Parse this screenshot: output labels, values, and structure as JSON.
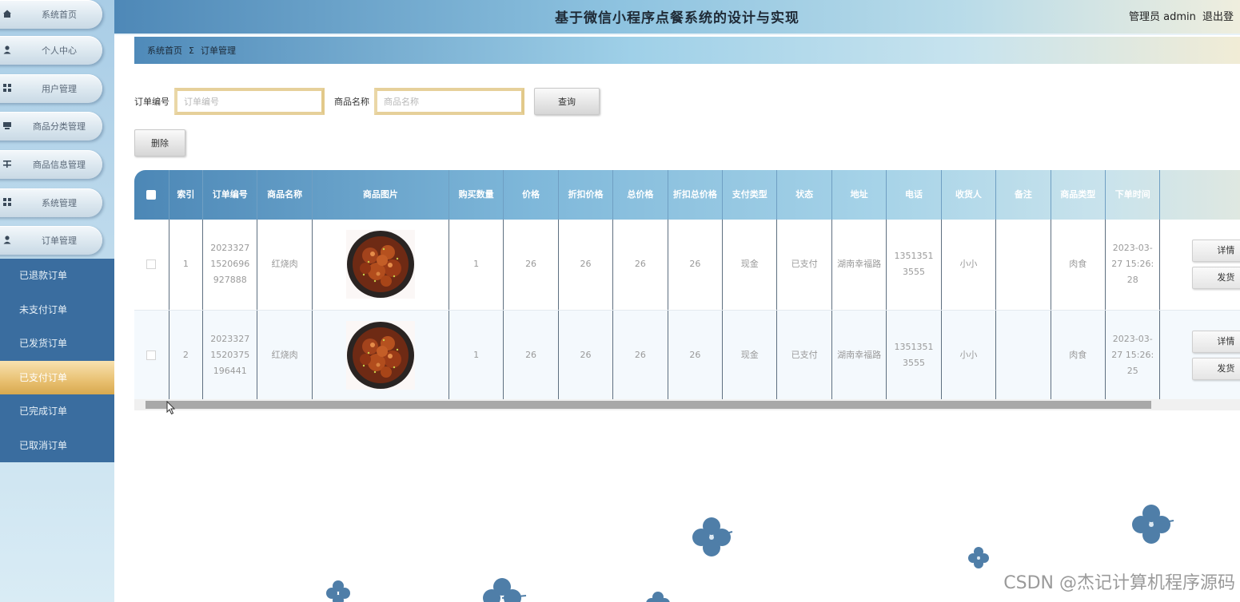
{
  "app": {
    "title": "基于微信小程序点餐系统的设计与实现",
    "user_label": "管理员 admin",
    "logout": "退出登"
  },
  "sidebar": {
    "items": [
      {
        "label": "系统首页",
        "icon": "home-icon"
      },
      {
        "label": "个人中心",
        "icon": "person-icon"
      },
      {
        "label": "用户管理",
        "icon": "grid-icon"
      },
      {
        "label": "商品分类管理",
        "icon": "list-icon"
      },
      {
        "label": "商品信息管理",
        "icon": "tree-icon"
      },
      {
        "label": "系统管理",
        "icon": "grid-icon"
      },
      {
        "label": "订单管理",
        "icon": "person-icon"
      }
    ],
    "submenu": [
      {
        "label": "已退款订单",
        "active": false
      },
      {
        "label": "未支付订单",
        "active": false
      },
      {
        "label": "已发货订单",
        "active": false
      },
      {
        "label": "已支付订单",
        "active": true
      },
      {
        "label": "已完成订单",
        "active": false
      },
      {
        "label": "已取消订单",
        "active": false
      }
    ]
  },
  "breadcrumb": {
    "home": "系统首页",
    "separator": "Σ",
    "current": "订单管理"
  },
  "search": {
    "order_no_label": "订单编号",
    "order_no_placeholder": "订单编号",
    "product_label": "商品名称",
    "product_placeholder": "商品名称",
    "query_button": "查询",
    "delete_button": "删除"
  },
  "table": {
    "columns": [
      "索引",
      "订单编号",
      "商品名称",
      "商品图片",
      "购买数量",
      "价格",
      "折扣价格",
      "总价格",
      "折扣总价格",
      "支付类型",
      "状态",
      "地址",
      "电话",
      "收货人",
      "备注",
      "商品类型",
      "下单时间"
    ],
    "rows": [
      {
        "index": "1",
        "order_no": "20233271520696927888",
        "product": "红烧肉",
        "qty": "1",
        "price": "26",
        "discount_price": "26",
        "total": "26",
        "discount_total": "26",
        "pay_type": "现金",
        "status": "已支付",
        "address": "湖南幸福路",
        "phone": "13513513555",
        "receiver": "小小",
        "remark": "",
        "category": "肉食",
        "time": "2023-03-27 15:26:28",
        "detail_btn": "详情",
        "ship_btn": "发货"
      },
      {
        "index": "2",
        "order_no": "20233271520375196441",
        "product": "红烧肉",
        "qty": "1",
        "price": "26",
        "discount_price": "26",
        "total": "26",
        "discount_total": "26",
        "pay_type": "现金",
        "status": "已支付",
        "address": "湖南幸福路",
        "phone": "13513513555",
        "receiver": "小小",
        "remark": "",
        "category": "肉食",
        "time": "2023-03-27 15:26:25",
        "detail_btn": "详情",
        "ship_btn": "发货"
      }
    ]
  },
  "watermark": "CSDN @杰记计算机程序源码",
  "colors": {
    "sidebar_dark": "#3a6d9f",
    "active_gold": "#e8c071",
    "header_blue": "#4e88b7",
    "flower": "#4f7ea8"
  }
}
